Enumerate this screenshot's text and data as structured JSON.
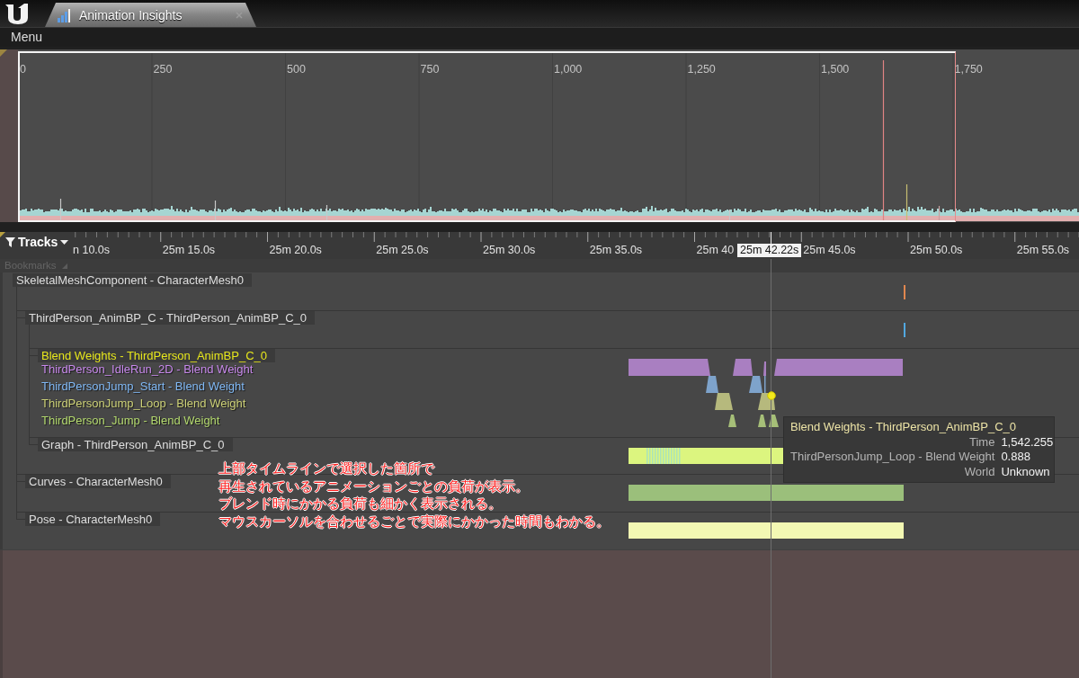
{
  "window": {
    "tab": {
      "title": "Animation Insights",
      "selected": true
    }
  },
  "menu_bar": {
    "items": [
      "Menu"
    ]
  },
  "frames_panel": {
    "axis_labels": [
      "0",
      "250",
      "500",
      "750",
      "1,000",
      "1,250",
      "1,500",
      "1,750"
    ]
  },
  "time_ruler": {
    "button": "Tracks",
    "labels": [
      "n 10.0s",
      "25m 15.0s",
      "25m 20.0s",
      "25m 25.0s",
      "25m 30.0s",
      "25m 35.0s",
      "25m 40",
      "25m 45.0s",
      "25m 50.0s",
      "25m 55.0s"
    ],
    "current_time": "25m 42.22s"
  },
  "bookmarks": {
    "label": "Bookmarks"
  },
  "tracks": [
    {
      "label": "SkeletalMeshComponent - CharacterMesh0",
      "kind": "event",
      "color": "#e0874f",
      "selected": false,
      "children": [
        {
          "label": "ThirdPerson_AnimBP_C - ThirdPerson_AnimBP_C_0",
          "kind": "event",
          "color": "#52a8e0",
          "selected": false,
          "children": [
            {
              "label": "Blend Weights - ThirdPerson_AnimBP_C_0",
              "kind": "blend_weights",
              "selected": true,
              "series": [
                {
                  "label": "ThirdPerson_IdleRun_2D - Blend Weight",
                  "color": "#a97fc1"
                },
                {
                  "label": "ThirdPersonJump_Start - Blend Weight",
                  "color": "#7ea3cb"
                },
                {
                  "label": "ThirdPersonJump_Loop - Blend Weight",
                  "color": "#b6b97d"
                },
                {
                  "label": "ThirdPerson_Jump - Blend Weight",
                  "color": "#a6bf78"
                }
              ]
            },
            {
              "label": "Graph - ThirdPerson_AnimBP_C_0",
              "kind": "graph",
              "color": "#dcf57f",
              "selected": false
            }
          ]
        },
        {
          "label": "Curves - CharacterMesh0",
          "kind": "bar",
          "color": "#9bbf7b",
          "selected": false
        },
        {
          "label": "Pose - CharacterMesh0",
          "kind": "bar",
          "color": "#f3f8b3",
          "selected": false
        }
      ]
    }
  ],
  "tooltip": {
    "title": "Blend Weights - ThirdPerson_AnimBP_C_0",
    "rows": [
      {
        "label": "Time",
        "value": "1,542.255"
      },
      {
        "label": "ThirdPersonJump_Loop - Blend Weight",
        "value": "0.888"
      },
      {
        "label": "World",
        "value": "Unknown"
      }
    ]
  },
  "annotation": {
    "lines": [
      "上部タイムラインで選択した箇所で",
      "再生されているアニメーションごとの負荷が表示。",
      "ブレンド時にかかる負荷も細かく表示される。",
      "マウスカーソルを合わせるごとで実際にかかった時間もわかる。"
    ]
  }
}
